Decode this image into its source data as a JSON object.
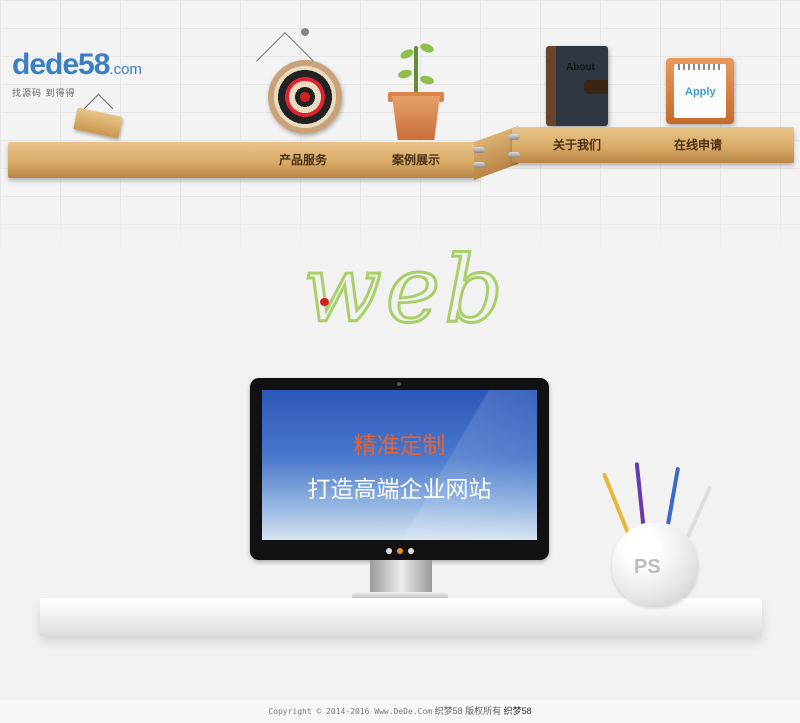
{
  "logo": {
    "brand_prefix": "dede",
    "brand_number": "58",
    "brand_suffix": ".com",
    "tagline": "找源码 到得得"
  },
  "nav": {
    "items": [
      {
        "label": "产品服务"
      },
      {
        "label": "案例展示"
      },
      {
        "label": "关于我们"
      },
      {
        "label": "在线申请"
      }
    ]
  },
  "decor": {
    "notebook_label": "About",
    "apply_label": "Apply",
    "cup_label": "PS"
  },
  "hero": {
    "word": "web",
    "headline": "精准定制",
    "subline": "打造高端企业网站"
  },
  "footer": {
    "copyright": "Copyright © 2014-2016 Www.DeDe.Com",
    "owner_prefix": "织梦58",
    "rights": "版权所有",
    "owner_link": "织梦58"
  },
  "colors": {
    "brand_blue": "#3a7fc4",
    "headline": "#e0643a",
    "vine_green": "#a9cf6a",
    "wood": "#d9ac68"
  }
}
